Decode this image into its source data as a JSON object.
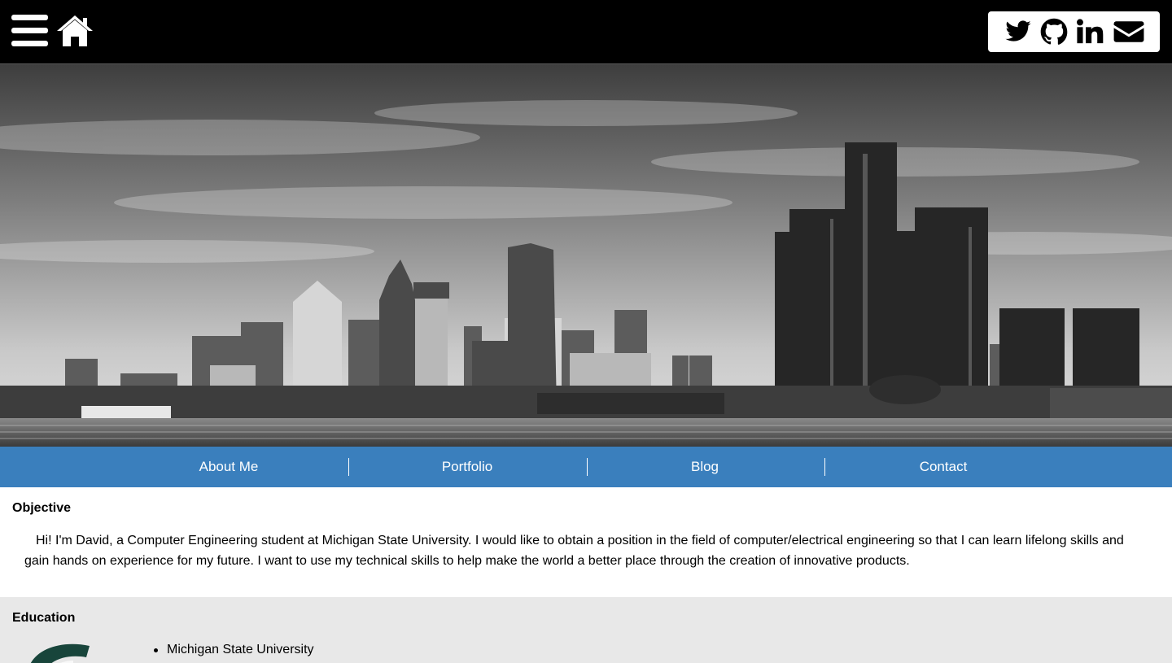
{
  "header": {
    "icons": [
      "hamburger-menu-icon",
      "home-icon"
    ],
    "social_icons": [
      "twitter-icon",
      "github-icon",
      "linkedin-icon",
      "envelope-icon"
    ]
  },
  "hero": {
    "description": "Black and white Detroit skyline banner"
  },
  "nav": {
    "items": [
      {
        "label": "About Me"
      },
      {
        "label": "Portfolio"
      },
      {
        "label": "Blog"
      },
      {
        "label": "Contact"
      }
    ]
  },
  "objective": {
    "title": "Objective",
    "text": "Hi! I'm David, a Computer Engineering student at Michigan State University. I would like to obtain a position in the field of computer/electrical engineering so that I can learn lifelong skills and gain hands on experience for my future. I want to use my technical skills to help make the world a better place through the creation of innovative products."
  },
  "education": {
    "title": "Education",
    "items": [
      "Michigan State University"
    ]
  },
  "colors": {
    "topbar_bg": "#000000",
    "nav_bg": "#3a7fbd",
    "education_bg": "#e8e8e8",
    "msu_green": "#18453b"
  }
}
